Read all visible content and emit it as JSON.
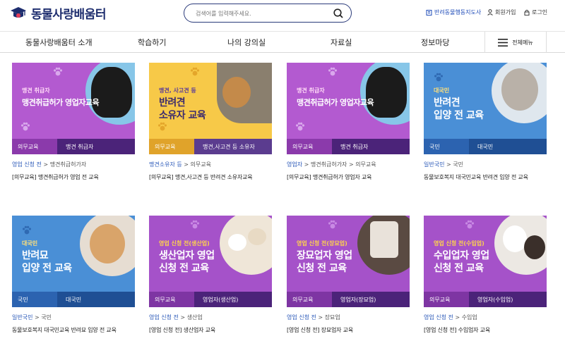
{
  "header": {
    "logo_text": "동물사랑배움터",
    "search_placeholder": "검색어를 입력해주세요.",
    "util_links": [
      "반려동물행동지도사",
      "회원가입",
      "로그인"
    ]
  },
  "nav": {
    "items": [
      "동물사랑배움터 소개",
      "학습하기",
      "나의 강의실",
      "자료실",
      "정보마당"
    ],
    "menu_label": "전체메뉴"
  },
  "courses": [
    {
      "thumb_tag": "맹견 취급자",
      "thumb_title": "맹견취급허가 영업자교육",
      "band_left": "의무교육",
      "band_right": "맹견 취급자",
      "cat_key": "영업 신청 전",
      "cat_sub": "맹견취급허가자",
      "caption": "[의무교육] 맹견취급허가 영업 전 교육"
    },
    {
      "thumb_tag": "맹견, 사고견 등",
      "thumb_title": "반려견\n소유자 교육",
      "band_left": "의무교육",
      "band_right": "맹견,사고견 등 소유자",
      "cat_key": "맹견소유자 등",
      "cat_sub": "의무교육",
      "caption": "[의무교육] 맹견,사고견 등 반려견 소유자교육"
    },
    {
      "thumb_tag": "맹견 취급자",
      "thumb_title": "맹견취급허가 영업자교육",
      "band_left": "의무교육",
      "band_right": "맹견 취급자",
      "cat_key": "영업자",
      "cat_sub": "맹견취급허가자 > 의무교육",
      "caption": "[의무교육] 맹견취급허가 영업자 교육"
    },
    {
      "thumb_tag": "대국민",
      "thumb_title": "반려견\n입양 전 교육",
      "band_left": "국민",
      "band_right": "대국민",
      "cat_key": "일반국민",
      "cat_sub": "국민",
      "caption": "동물보호복지 대국민교육 반려견 입양 전 교육"
    },
    {
      "thumb_tag": "대국민",
      "thumb_title": "반려묘\n입양 전 교육",
      "band_left": "국민",
      "band_right": "대국민",
      "cat_key": "일반국민",
      "cat_sub": "국민",
      "caption": "동물보호복지 대국민교육 반려묘 입양 전 교육"
    },
    {
      "thumb_tag": "영업 신청 전(생산업)",
      "thumb_title": "생산업자 영업\n신청 전 교육",
      "band_left": "의무교육",
      "band_right": "영업자(생산업)",
      "cat_key": "영업 신청 전",
      "cat_sub": "생산업",
      "caption": "[영업 신청 전] 생산업자 교육"
    },
    {
      "thumb_tag": "영업 신청 전(장묘업)",
      "thumb_title": "장묘업자 영업\n신청 전 교육",
      "band_left": "의무교육",
      "band_right": "영업자(장묘업)",
      "cat_key": "영업 신청 전",
      "cat_sub": "장묘업",
      "caption": "[영업 신청 전] 장묘업자 교육"
    },
    {
      "thumb_tag": "영업 신청 전(수입업)",
      "thumb_title": "수입업자 영업\n신청 전 교육",
      "band_left": "의무교육",
      "band_right": "영업자(수입업)",
      "cat_key": "영업 신청 전",
      "cat_sub": "수입업",
      "caption": "[영업 신청 전] 수입업자 교육"
    }
  ],
  "icons": {
    "logo": "graduation-cap-icon",
    "search": "search-icon",
    "menu": "hamburger-icon",
    "paw": "paw-icon",
    "chevron": "chevron-right-icon"
  },
  "colors": {
    "brand_navy": "#1d2d6e",
    "purple": "#a552c9",
    "blue": "#4a8fd6",
    "yellow": "#f7c948",
    "accent_link": "#2a58b8"
  }
}
